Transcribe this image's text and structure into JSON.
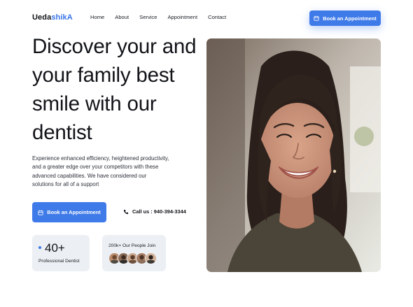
{
  "header": {
    "logo_part1": "Ueda",
    "logo_part2": "shikA",
    "nav": [
      "Home",
      "About",
      "Service",
      "Appointment",
      "Contact"
    ],
    "cta_label": "Book an Appointment"
  },
  "hero": {
    "line1": "Discover your and",
    "line2": "your family best",
    "line3": "smile with our",
    "line4": "dentist",
    "description": "Experience enhanced efficiency, heightened productivity, and a greater edge over your competitors with these advanced capabilities. We have considered our solutions for all of a support",
    "cta_label": "Book an Appointment",
    "call_label": "Call us : 940-394-3344"
  },
  "stats": {
    "value": "40+",
    "label": "Professional Dentist",
    "join_label": "200k+ Our People Join"
  },
  "colors": {
    "accent": "#3f7ae9",
    "card": "#eceff3"
  },
  "icons": [
    "calendar-icon",
    "phone-icon"
  ]
}
